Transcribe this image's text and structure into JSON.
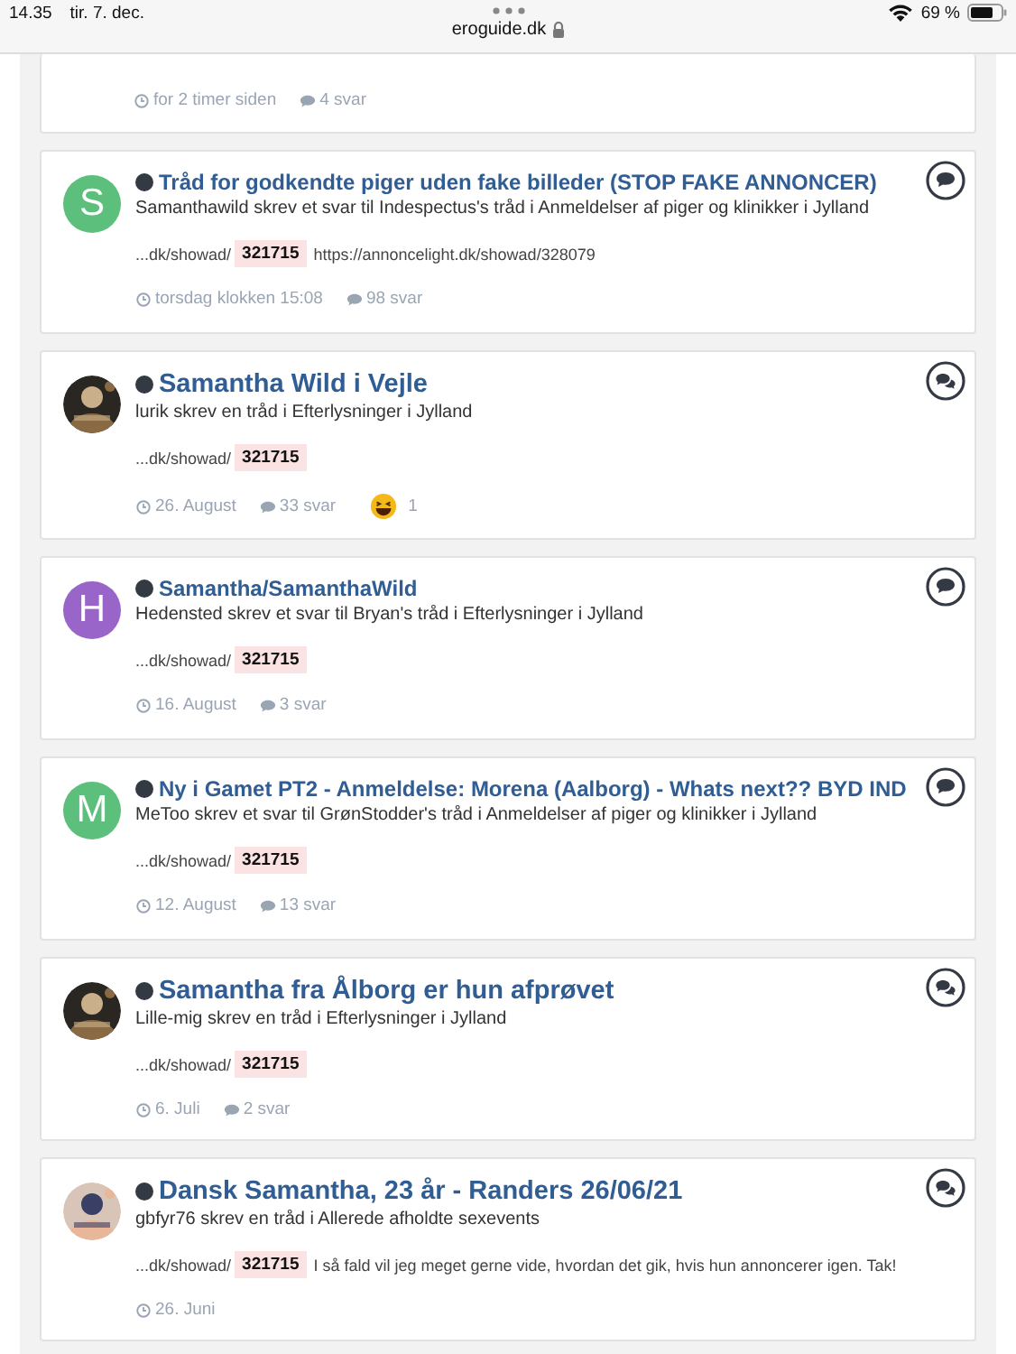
{
  "status_bar": {
    "time": "14.35",
    "date": "tir. 7. dec.",
    "url": "eroguide.dk",
    "battery": "69 %"
  },
  "partial_result": {
    "date": "for 2 timer siden",
    "replies": "4 svar"
  },
  "results": [
    {
      "kind": "reply",
      "avatar": {
        "kind": "letter",
        "letter": "S",
        "color": "#5cbf7c"
      },
      "title": "Tråd for godkendte piger uden fake billeder (STOP FAKE ANNONCER)",
      "byline": "Samanthawild skrev et svar til Indespectus's tråd i Anmeldelser af piger og klinikker i Jylland",
      "snippet_prefix": "...dk/showad/",
      "highlight": "321715",
      "snippet_rest": "https://annoncelight.dk/showad/328079",
      "date": "torsdag klokken 15:08",
      "replies": "98 svar"
    },
    {
      "kind": "topic",
      "title": "Samantha Wild i Vejle",
      "byline": "lurik skrev en tråd i Efterlysninger i Jylland",
      "snippet_prefix": "...dk/showad/",
      "highlight": "321715",
      "date": "26. August",
      "replies": "33 svar",
      "reaction_count": "1"
    },
    {
      "kind": "reply",
      "avatar": {
        "kind": "letter",
        "letter": "H",
        "color": "#9a65c8"
      },
      "title": "Samantha/SamanthaWild",
      "byline": "Hedensted skrev et svar til Bryan's tråd i Efterlysninger i Jylland",
      "snippet_prefix": "...dk/showad/",
      "highlight": "321715",
      "date": "16. August",
      "replies": "3 svar"
    },
    {
      "kind": "reply",
      "avatar": {
        "kind": "letter",
        "letter": "M",
        "color": "#5cbf7c"
      },
      "title": "Ny i Gamet PT2 - Anmeldelse: Morena (Aalborg) - Whats next?? BYD IND",
      "byline": "MeToo skrev et svar til GrønStodder's tråd i Anmeldelser af piger og klinikker i Jylland",
      "snippet_prefix": "...dk/showad/",
      "highlight": "321715",
      "date": "12. August",
      "replies": "13 svar"
    },
    {
      "kind": "topic",
      "title": "Samantha fra Ålborg er hun afprøvet",
      "byline": "Lille-mig skrev en tråd i Efterlysninger i Jylland",
      "snippet_prefix": "...dk/showad/",
      "highlight": "321715",
      "date": "6. Juli",
      "replies": "2 svar"
    },
    {
      "kind": "topic",
      "title": "Dansk Samantha, 23 år - Randers 26/06/21",
      "byline": "gbfyr76 skrev en tråd i Allerede afholdte sexevents",
      "snippet_prefix": "...dk/showad/",
      "highlight": "321715",
      "snippet_rest": "I så fald vil jeg meget gerne vide, hvordan det gik, hvis hun annoncerer igen. Tak!",
      "date": "26. Juni"
    }
  ]
}
